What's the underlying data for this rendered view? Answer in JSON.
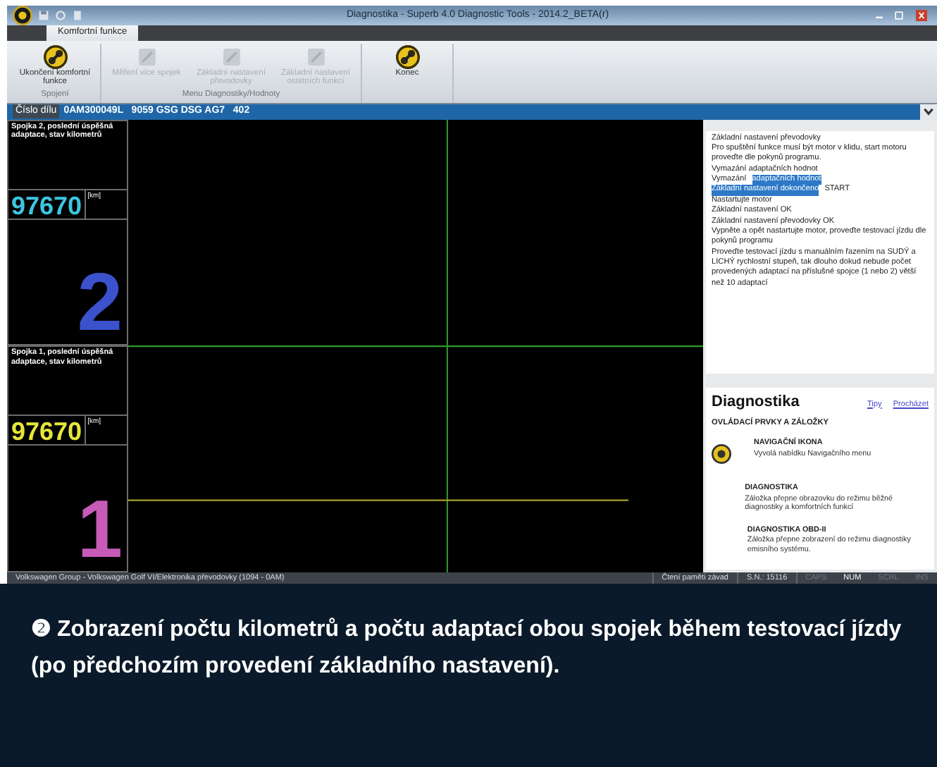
{
  "window": {
    "title": "Diagnostika - Superb 4.0 Diagnostic Tools - 2014.2_BETA(r)"
  },
  "tabs": [
    {
      "label": "Komfortní funkce",
      "selected": true
    }
  ],
  "ribbon_groups": [
    {
      "label": "Spojení",
      "buttons": [
        {
          "label": "Ukončení komfortní funkce",
          "disabled": false
        }
      ]
    },
    {
      "label": "Menu Diagnostiky/Hodnoty",
      "buttons": [
        {
          "label": "Měření více spojek",
          "disabled": true
        },
        {
          "label": "Základní nastavení převodovky",
          "disabled": true
        },
        {
          "label": "Základní nastavení ostatních funkcí",
          "disabled": true
        }
      ]
    },
    {
      "buttons": [
        {
          "label": "Konec",
          "disabled": false
        }
      ]
    }
  ],
  "part_number": {
    "label": "Číslo dílu",
    "value": "0AM300049L   9059 GSG DSG AG7   402"
  },
  "gauges": [
    {
      "title": "Spojka 2, poslední úspěšná adaptace, stav kilometrů",
      "value": {
        "text": "97670",
        "color": "#3cc6e0"
      },
      "unit": "[km]",
      "number": {
        "text": "2",
        "color": "#3b52cc"
      }
    },
    {
      "title": "Spojka 1, poslední úspěšná adaptace, stav kilometrů",
      "value": {
        "text": "97670",
        "color": "#e6e63a"
      },
      "unit": "[km]",
      "number": {
        "text": "1",
        "color": "#c85ab8"
      }
    }
  ],
  "log": [
    {
      "segments": [
        {
          "text": "Základní nastavení převodovky",
          "selected": false
        }
      ]
    },
    {
      "segments": [
        {
          "text": "Pro spuštění funkce musí být motor v klidu, start motoru proveďte dle pokynů programu.",
          "selected": false
        }
      ]
    },
    {
      "segments": [
        {
          "text": "Vymazání adaptačních hodnot",
          "selected": false
        }
      ]
    },
    {
      "segments": [
        {
          "text": "Vymazání",
          "selected": false
        },
        {
          "text": "adaptačních hodnot",
          "selected": true
        }
      ]
    },
    {
      "segments": [
        {
          "text": "Základní nastavení dokončeno",
          "selected": true
        },
        {
          "text": "START",
          "selected": false
        }
      ]
    },
    {
      "segments": [
        {
          "text": "Nastartujte motor",
          "selected": false
        }
      ]
    },
    {
      "segments": [
        {
          "text": "Základní nastavení OK",
          "selected": false
        }
      ]
    },
    {
      "segments": [
        {
          "text": "Základní nastavení převodovky OK",
          "selected": false
        }
      ]
    },
    {
      "segments": [
        {
          "text": "Vypněte a opět nastartujte motor, proveďte testovací jízdu dle pokynů programu",
          "selected": false
        }
      ]
    },
    {
      "segments": [
        {
          "text": "Proveďte testovací jízdu s manuálním řazením na SUDÝ a LICHÝ rychlostní stupeň, tak dlouho dokud nebude počet provedených adaptací na příslušné spojce (1 nebo 2) větší než 10 adaptací",
          "selected": false
        }
      ]
    }
  ],
  "help": {
    "title": "Diagnostika",
    "links": [
      "Tipy",
      "Procházet"
    ],
    "section": "OVLÁDACÍ PRVKY A ZÁLOŽKY",
    "entries": [
      {
        "kind": "icon",
        "heading": "NAVIGAČNÍ IKONA",
        "text": "Vyvolá nabídku Navigačního menu"
      },
      {
        "kind": "plain",
        "heading": "DIAGNOSTIKA",
        "text": "Záložka přepne obrazovku do režimu běžné diagnostiky a komfortních funkcí"
      },
      {
        "kind": "plain",
        "heading": "DIAGNOSTIKA OBD-II",
        "text": "Záložka přepne zobrazení do režimu diagnostiky emisního systému."
      }
    ]
  },
  "status_bar": {
    "text": "Volkswagen Group - Volkswagen Golf VI/Elektronika převodovky (1094 - 0AM)",
    "operation": "Čtení paměti závad",
    "serial": "S.N.: 15116",
    "indicators": [
      {
        "label": "CAPS",
        "on": false
      },
      {
        "label": "NUM",
        "on": true
      },
      {
        "label": "SCRL",
        "on": false
      },
      {
        "label": "INS",
        "on": false
      }
    ]
  },
  "caption": {
    "marker": "❷",
    "text": "Zobrazení počtu kilometrů a počtu adaptací obou spojek během testovací jízdy (po předchozím provedení základního nastavení)."
  }
}
